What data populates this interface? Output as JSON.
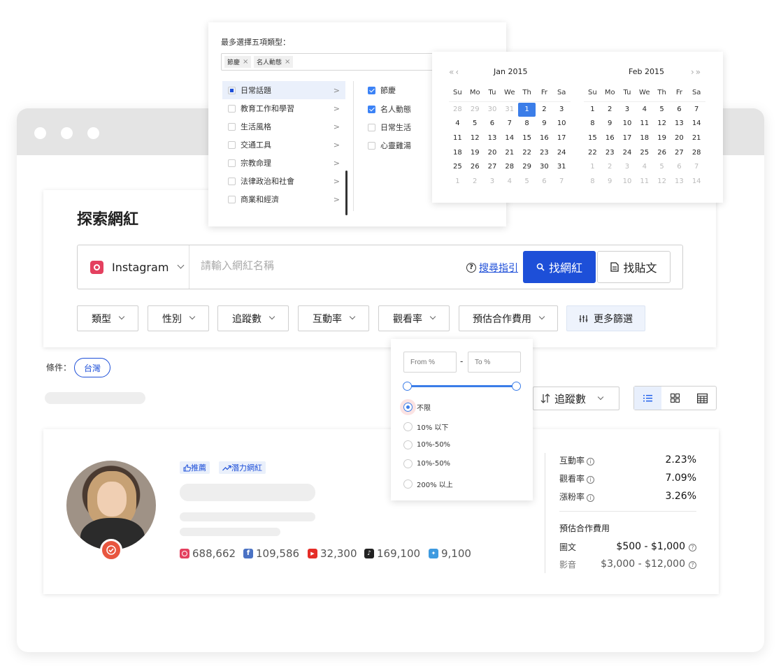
{
  "page": {
    "title": "探索網紅",
    "accent_color": "#1d4fd8",
    "conditions_label": "條件：",
    "condition_tags": [
      "台灣"
    ]
  },
  "search": {
    "platform": "Instagram",
    "platform_icon": "instagram-icon",
    "placeholder": "請輸入網紅名稱",
    "guide_label": "搜尋指引",
    "find_influencer_label": "找網紅",
    "find_post_label": "找貼文"
  },
  "filters": [
    "類型",
    "性別",
    "追蹤數",
    "互動率",
    "觀看率",
    "預估合作費用"
  ],
  "more_filters_label": "更多篩選",
  "sort": {
    "label": "追蹤數"
  },
  "category_dropdown": {
    "prompt": "最多選擇五項類型：",
    "selected_tags": [
      "節慶",
      "名人動態"
    ],
    "categories": [
      "日常話題",
      "教育工作和學習",
      "生活風格",
      "交通工具",
      "宗教命理",
      "法律政治和社會",
      "商業和經濟"
    ],
    "subcategories": [
      {
        "label": "節慶",
        "checked": true
      },
      {
        "label": "名人動態",
        "checked": true
      },
      {
        "label": "日常生活",
        "checked": false
      },
      {
        "label": "心靈雞湯",
        "checked": false
      }
    ]
  },
  "calendar": {
    "weekdays": [
      "Su",
      "Mo",
      "Tu",
      "We",
      "Th",
      "Fr",
      "Sa"
    ],
    "months": [
      {
        "title": "Jan  2015",
        "days": [
          "28",
          "29",
          "30",
          "31",
          "1",
          "2",
          "3",
          "4",
          "5",
          "6",
          "7",
          "8",
          "9",
          "10",
          "11",
          "12",
          "13",
          "14",
          "15",
          "16",
          "17",
          "18",
          "19",
          "20",
          "21",
          "22",
          "23",
          "24",
          "25",
          "26",
          "27",
          "28",
          "29",
          "30",
          "31",
          "1",
          "2",
          "3",
          "4",
          "5",
          "6",
          "7"
        ],
        "muted": [
          0,
          1,
          2,
          3,
          35,
          36,
          37,
          38,
          39,
          40,
          41
        ],
        "selected": 4
      },
      {
        "title": "Feb  2015",
        "days": [
          "1",
          "2",
          "3",
          "4",
          "5",
          "6",
          "7",
          "8",
          "9",
          "10",
          "11",
          "12",
          "13",
          "14",
          "15",
          "16",
          "17",
          "18",
          "19",
          "20",
          "21",
          "22",
          "23",
          "24",
          "25",
          "26",
          "27",
          "28",
          "1",
          "2",
          "3",
          "4",
          "5",
          "6",
          "7",
          "8",
          "9",
          "10",
          "11",
          "12",
          "13",
          "14"
        ],
        "muted": [
          28,
          29,
          30,
          31,
          32,
          33,
          34,
          35,
          36,
          37,
          38,
          39,
          40,
          41
        ],
        "selected": -1
      }
    ]
  },
  "engagement_popover": {
    "from_placeholder": "From %",
    "to_placeholder": "To %",
    "dash": "-",
    "options": [
      "不限",
      "10% 以下",
      "10%-50%",
      "10%-50%",
      "200% 以上"
    ],
    "selected_index": 0
  },
  "result": {
    "badges": [
      "推薦",
      "潛力網紅"
    ],
    "stats": [
      {
        "icon": "instagram-icon",
        "value": "688,662",
        "color": "#e4405f"
      },
      {
        "icon": "facebook-icon",
        "value": "109,586",
        "color": "#4a72c4"
      },
      {
        "icon": "youtube-icon",
        "value": "32,300",
        "color": "#e52d27"
      },
      {
        "icon": "tiktok-icon",
        "value": "169,100",
        "color": "#222222"
      },
      {
        "icon": "twitter-icon",
        "value": "9,100",
        "color": "#3d9ae0"
      }
    ],
    "metrics": [
      {
        "label": "互動率",
        "value": "2.23%"
      },
      {
        "label": "觀看率",
        "value": "7.09%"
      },
      {
        "label": "漲粉率",
        "value": "3.26%"
      }
    ],
    "fee_title": "預估合作費用",
    "fees": [
      {
        "label": "圖文",
        "value": "$500 - $1,000"
      },
      {
        "label": "影音",
        "value": "$3,000 - $12,000"
      }
    ]
  }
}
